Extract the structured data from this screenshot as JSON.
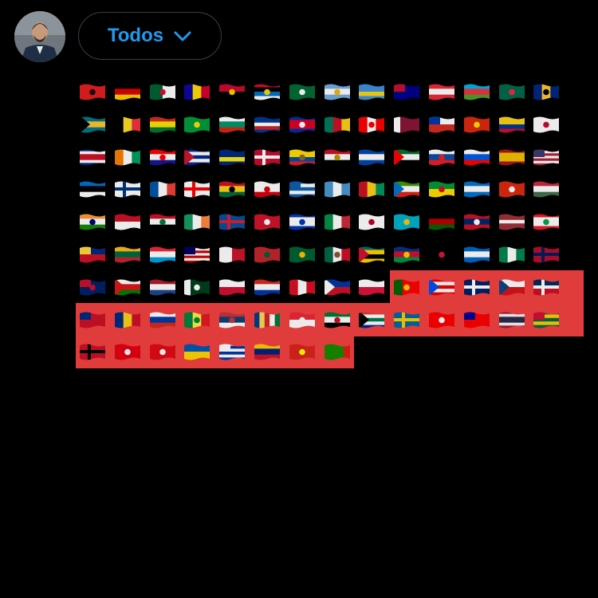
{
  "header": {
    "avatar_alt": "avatar",
    "dropdown": {
      "label": "Todos",
      "icon": "chevron-down-icon"
    }
  },
  "colors": {
    "accent": "#1d9bf0",
    "highlight": "#e03c3c",
    "background": "#000000"
  },
  "flags": [
    {
      "name": "albania",
      "bands": [
        "#e41e20"
      ],
      "dir": "h",
      "emblem": "#111"
    },
    {
      "name": "germany",
      "bands": [
        "#000",
        "#dd0000",
        "#ffce00"
      ],
      "dir": "h"
    },
    {
      "name": "algeria",
      "bands": [
        "#006233",
        "#ffffff"
      ],
      "dir": "v",
      "emblem": "#d21034"
    },
    {
      "name": "andorra",
      "bands": [
        "#10069f",
        "#fedd00",
        "#d50032"
      ],
      "dir": "v"
    },
    {
      "name": "angola",
      "bands": [
        "#cc092f",
        "#000000"
      ],
      "dir": "h",
      "emblem": "#ffcb00"
    },
    {
      "name": "antigua-barbuda",
      "bands": [
        "#ce1126",
        "#000",
        "#0072c6",
        "#fff"
      ],
      "dir": "h",
      "emblem": "#fcd116"
    },
    {
      "name": "saudi-arabia",
      "bands": [
        "#006c35"
      ],
      "dir": "h",
      "emblem": "#fff"
    },
    {
      "name": "argentina",
      "bands": [
        "#74acdf",
        "#ffffff",
        "#74acdf"
      ],
      "dir": "h",
      "emblem": "#f6b40e"
    },
    {
      "name": "aruba",
      "bands": [
        "#418fde",
        "#418fde",
        "#f9d616",
        "#418fde"
      ],
      "dir": "h"
    },
    {
      "name": "australia",
      "bands": [
        "#00008b"
      ],
      "dir": "h",
      "canton": "#c8102e"
    },
    {
      "name": "austria",
      "bands": [
        "#ed2939",
        "#ffffff",
        "#ed2939"
      ],
      "dir": "h"
    },
    {
      "name": "azerbaijan",
      "bands": [
        "#00b5e2",
        "#ef3340",
        "#509e2f"
      ],
      "dir": "h"
    },
    {
      "name": "bangladesh",
      "bands": [
        "#006a4e"
      ],
      "dir": "h",
      "emblem": "#f42a41"
    },
    {
      "name": "barbados",
      "bands": [
        "#00267f",
        "#ffc726",
        "#00267f"
      ],
      "dir": "v",
      "emblem": "#000"
    },
    {
      "name": "bahamas",
      "bands": [
        "#00778b",
        "#ffc72c",
        "#00778b"
      ],
      "dir": "h",
      "tri": "#000"
    },
    {
      "name": "belgium",
      "bands": [
        "#000",
        "#fdda24",
        "#ef3340"
      ],
      "dir": "v"
    },
    {
      "name": "bolivia",
      "bands": [
        "#d52b1e",
        "#f9e300",
        "#007934"
      ],
      "dir": "h"
    },
    {
      "name": "brazil",
      "bands": [
        "#009c3b"
      ],
      "dir": "h",
      "emblem": "#ffdf00"
    },
    {
      "name": "bulgaria",
      "bands": [
        "#ffffff",
        "#00966e",
        "#d62612"
      ],
      "dir": "h"
    },
    {
      "name": "cape-verde",
      "bands": [
        "#003893",
        "#003893",
        "#fff",
        "#cf2027",
        "#003893"
      ],
      "dir": "h"
    },
    {
      "name": "cambodia",
      "bands": [
        "#032ea1",
        "#e00025",
        "#e00025",
        "#032ea1"
      ],
      "dir": "h",
      "emblem": "#fff"
    },
    {
      "name": "cameroon",
      "bands": [
        "#007a5e",
        "#ce1126",
        "#fcd116"
      ],
      "dir": "v"
    },
    {
      "name": "canada",
      "bands": [
        "#ff0000",
        "#ffffff",
        "#ff0000"
      ],
      "dir": "v",
      "emblem": "#ff0000"
    },
    {
      "name": "qatar",
      "bands": [
        "#ffffff",
        "#8a1538",
        "#8a1538",
        "#8a1538"
      ],
      "dir": "v"
    },
    {
      "name": "chile",
      "bands": [
        "#ffffff",
        "#d52b1e"
      ],
      "dir": "h",
      "canton": "#0039a6"
    },
    {
      "name": "china",
      "bands": [
        "#de2910"
      ],
      "dir": "h",
      "canton": "#de2910",
      "emblem": "#ffde00"
    },
    {
      "name": "colombia",
      "bands": [
        "#fcd116",
        "#fcd116",
        "#003893",
        "#ce1126"
      ],
      "dir": "h"
    },
    {
      "name": "south-korea",
      "bands": [
        "#ffffff"
      ],
      "dir": "h",
      "emblem": "#c60c30"
    },
    {
      "name": "costa-rica",
      "bands": [
        "#002b7f",
        "#fff",
        "#ce1126",
        "#ce1126",
        "#fff",
        "#002b7f"
      ],
      "dir": "h"
    },
    {
      "name": "ivory-coast",
      "bands": [
        "#f77f00",
        "#ffffff",
        "#009e60"
      ],
      "dir": "v"
    },
    {
      "name": "croatia",
      "bands": [
        "#ff0000",
        "#ffffff",
        "#171796"
      ],
      "dir": "h",
      "emblem": "#ff0000"
    },
    {
      "name": "cuba",
      "bands": [
        "#002a8f",
        "#fff",
        "#002a8f",
        "#fff",
        "#002a8f"
      ],
      "dir": "h",
      "tri": "#cf142b"
    },
    {
      "name": "curacao",
      "bands": [
        "#002b7f",
        "#002b7f",
        "#f9e814",
        "#002b7f"
      ],
      "dir": "h"
    },
    {
      "name": "denmark",
      "bands": [
        "#c60c30"
      ],
      "dir": "h",
      "cross": "#fff"
    },
    {
      "name": "ecuador",
      "bands": [
        "#ffdd00",
        "#ffdd00",
        "#034ea2",
        "#ed1c24"
      ],
      "dir": "h",
      "emblem": "#8b6b2e"
    },
    {
      "name": "egypt",
      "bands": [
        "#ce1126",
        "#ffffff",
        "#000000"
      ],
      "dir": "h",
      "emblem": "#c09300"
    },
    {
      "name": "el-salvador",
      "bands": [
        "#0047ab",
        "#ffffff",
        "#0047ab"
      ],
      "dir": "h"
    },
    {
      "name": "uae",
      "bands": [
        "#00732f",
        "#ffffff",
        "#000000"
      ],
      "dir": "h",
      "tri": "#ff0000"
    },
    {
      "name": "slovakia",
      "bands": [
        "#ffffff",
        "#0b4ea2",
        "#ee1c25"
      ],
      "dir": "h",
      "emblem": "#ee1c25"
    },
    {
      "name": "slovenia",
      "bands": [
        "#ffffff",
        "#005ce6",
        "#ff0000"
      ],
      "dir": "h"
    },
    {
      "name": "spain",
      "bands": [
        "#aa151b",
        "#f1bf00",
        "#f1bf00",
        "#aa151b"
      ],
      "dir": "h"
    },
    {
      "name": "united-states",
      "bands": [
        "#b22234",
        "#fff",
        "#b22234",
        "#fff",
        "#b22234",
        "#fff",
        "#b22234"
      ],
      "dir": "h",
      "canton": "#3c3b6e"
    },
    {
      "name": "estonia",
      "bands": [
        "#0072ce",
        "#000000",
        "#ffffff"
      ],
      "dir": "h"
    },
    {
      "name": "finland",
      "bands": [
        "#ffffff"
      ],
      "dir": "h",
      "cross": "#003580"
    },
    {
      "name": "france",
      "bands": [
        "#0055a4",
        "#ffffff",
        "#ef4135"
      ],
      "dir": "v"
    },
    {
      "name": "georgia",
      "bands": [
        "#ffffff"
      ],
      "dir": "h",
      "cross": "#ff0000"
    },
    {
      "name": "ghana",
      "bands": [
        "#ce1126",
        "#fcd116",
        "#006b3f"
      ],
      "dir": "h",
      "emblem": "#000"
    },
    {
      "name": "gibraltar",
      "bands": [
        "#ffffff",
        "#ffffff",
        "#da000c"
      ],
      "dir": "h",
      "emblem": "#da000c"
    },
    {
      "name": "greece",
      "bands": [
        "#0d5eaf",
        "#fff",
        "#0d5eaf",
        "#fff",
        "#0d5eaf"
      ],
      "dir": "h",
      "canton": "#0d5eaf"
    },
    {
      "name": "guatemala",
      "bands": [
        "#4997d0",
        "#ffffff",
        "#4997d0"
      ],
      "dir": "v"
    },
    {
      "name": "guinea",
      "bands": [
        "#ce1126",
        "#fcd116",
        "#009460"
      ],
      "dir": "v"
    },
    {
      "name": "equatorial-guinea",
      "bands": [
        "#3e9a00",
        "#ffffff",
        "#e32118"
      ],
      "dir": "h",
      "tri": "#0073ce"
    },
    {
      "name": "french-guiana",
      "bands": [
        "#009739",
        "#fedf00"
      ],
      "dir": "h",
      "emblem": "#e20e17"
    },
    {
      "name": "honduras",
      "bands": [
        "#0073cf",
        "#ffffff",
        "#0073cf"
      ],
      "dir": "h"
    },
    {
      "name": "hong-kong",
      "bands": [
        "#de2910"
      ],
      "dir": "h",
      "emblem": "#fff"
    },
    {
      "name": "hungary",
      "bands": [
        "#cd2a3e",
        "#ffffff",
        "#436f4d"
      ],
      "dir": "h"
    },
    {
      "name": "india",
      "bands": [
        "#ff9933",
        "#ffffff",
        "#138808"
      ],
      "dir": "h",
      "emblem": "#000080"
    },
    {
      "name": "indonesia",
      "bands": [
        "#ce1126",
        "#ffffff"
      ],
      "dir": "h"
    },
    {
      "name": "iraq",
      "bands": [
        "#ce1126",
        "#ffffff",
        "#000000"
      ],
      "dir": "h",
      "emblem": "#007a3d"
    },
    {
      "name": "ireland",
      "bands": [
        "#169b62",
        "#ffffff",
        "#ff883e"
      ],
      "dir": "v"
    },
    {
      "name": "iceland",
      "bands": [
        "#02529c"
      ],
      "dir": "h",
      "cross": "#dc1e35"
    },
    {
      "name": "isle-of-man",
      "bands": [
        "#cf142b"
      ],
      "dir": "h",
      "emblem": "#fff"
    },
    {
      "name": "israel",
      "bands": [
        "#0038b8",
        "#ffffff",
        "#ffffff",
        "#0038b8"
      ],
      "dir": "h",
      "emblem": "#0038b8"
    },
    {
      "name": "italy",
      "bands": [
        "#009246",
        "#ffffff",
        "#ce2b37"
      ],
      "dir": "v"
    },
    {
      "name": "japan",
      "bands": [
        "#ffffff"
      ],
      "dir": "h",
      "emblem": "#bc002d"
    },
    {
      "name": "kazakhstan",
      "bands": [
        "#00afca"
      ],
      "dir": "h",
      "emblem": "#fec50c"
    },
    {
      "name": "kenya",
      "bands": [
        "#000000",
        "#bb0000",
        "#006600"
      ],
      "dir": "h",
      "emblem": "#bb0000"
    },
    {
      "name": "laos",
      "bands": [
        "#ce1126",
        "#002868",
        "#ce1126"
      ],
      "dir": "h",
      "emblem": "#fff"
    },
    {
      "name": "latvia",
      "bands": [
        "#9e3039",
        "#9e3039",
        "#ffffff",
        "#9e3039",
        "#9e3039"
      ],
      "dir": "h"
    },
    {
      "name": "lebanon",
      "bands": [
        "#ed1c24",
        "#ffffff",
        "#ffffff",
        "#ed1c24"
      ],
      "dir": "h",
      "emblem": "#00a651"
    },
    {
      "name": "liechtenstein",
      "bands": [
        "#002b7f",
        "#ce1126"
      ],
      "dir": "h",
      "canton": "#ffd83d"
    },
    {
      "name": "lithuania",
      "bands": [
        "#fdb913",
        "#006a44",
        "#c1272d"
      ],
      "dir": "h"
    },
    {
      "name": "luxembourg",
      "bands": [
        "#ed2939",
        "#ffffff",
        "#00a1de"
      ],
      "dir": "h"
    },
    {
      "name": "malaysia",
      "bands": [
        "#cc0001",
        "#fff",
        "#cc0001",
        "#fff",
        "#cc0001",
        "#fff",
        "#cc0001"
      ],
      "dir": "h",
      "canton": "#010066"
    },
    {
      "name": "malta",
      "bands": [
        "#ffffff",
        "#cf142b"
      ],
      "dir": "v"
    },
    {
      "name": "morocco",
      "bands": [
        "#c1272d"
      ],
      "dir": "h",
      "emblem": "#006233"
    },
    {
      "name": "mauritania",
      "bands": [
        "#006233"
      ],
      "dir": "h",
      "emblem": "#ffc400"
    },
    {
      "name": "mexico",
      "bands": [
        "#006847",
        "#ffffff",
        "#ce1126"
      ],
      "dir": "v",
      "emblem": "#8b5a2b"
    },
    {
      "name": "mozambique",
      "bands": [
        "#007168",
        "#ffd100",
        "#000000",
        "#ffd100"
      ],
      "dir": "h",
      "tri": "#d21034"
    },
    {
      "name": "namibia",
      "bands": [
        "#003580",
        "#d21034",
        "#009543"
      ],
      "dir": "h",
      "emblem": "#ffce00"
    },
    {
      "name": "nepal",
      "bands": [
        "#000000"
      ],
      "dir": "h",
      "emblem": "#dc143c"
    },
    {
      "name": "nicaragua",
      "bands": [
        "#0067c6",
        "#ffffff",
        "#0067c6"
      ],
      "dir": "h"
    },
    {
      "name": "nigeria",
      "bands": [
        "#008751",
        "#ffffff",
        "#008751"
      ],
      "dir": "v"
    },
    {
      "name": "norway",
      "bands": [
        "#ba0c2f"
      ],
      "dir": "h",
      "cross": "#00205b"
    },
    {
      "name": "new-zealand",
      "bands": [
        "#012169"
      ],
      "dir": "h",
      "canton": "#c8102e",
      "emblem": "#c8102e"
    },
    {
      "name": "oman",
      "bands": [
        "#ffffff",
        "#db161b",
        "#008000"
      ],
      "dir": "h",
      "tri": "#db161b"
    },
    {
      "name": "netherlands",
      "bands": [
        "#ae1c28",
        "#ffffff",
        "#21468b"
      ],
      "dir": "h"
    },
    {
      "name": "pakistan",
      "bands": [
        "#ffffff",
        "#01411c",
        "#01411c",
        "#01411c"
      ],
      "dir": "v",
      "emblem": "#fff"
    },
    {
      "name": "panama",
      "bands": [
        "#ffffff",
        "#d21034"
      ],
      "dir": "h",
      "canton": "#ffffff"
    },
    {
      "name": "paraguay",
      "bands": [
        "#d52b1e",
        "#ffffff",
        "#0038a8"
      ],
      "dir": "h"
    },
    {
      "name": "peru",
      "bands": [
        "#d91023",
        "#ffffff",
        "#d91023"
      ],
      "dir": "v"
    },
    {
      "name": "philippines",
      "bands": [
        "#0038a8",
        "#ce1126"
      ],
      "dir": "h",
      "tri": "#ffffff"
    },
    {
      "name": "poland",
      "bands": [
        "#ffffff",
        "#dc143c"
      ],
      "dir": "h"
    },
    {
      "name": "portugal",
      "bands": [
        "#006600",
        "#ff0000",
        "#ff0000"
      ],
      "dir": "v",
      "emblem": "#ffcc00"
    },
    {
      "name": "puerto-rico",
      "bands": [
        "#ed0000",
        "#fff",
        "#ed0000",
        "#fff",
        "#ed0000"
      ],
      "dir": "h",
      "tri": "#0050f0"
    },
    {
      "name": "united-kingdom",
      "bands": [
        "#012169"
      ],
      "dir": "h",
      "cross": "#ffffff"
    },
    {
      "name": "czech-republic",
      "bands": [
        "#ffffff",
        "#d7141a"
      ],
      "dir": "h",
      "tri": "#11457e"
    },
    {
      "name": "dominican-republic",
      "bands": [
        "#002d62",
        "#ce1126"
      ],
      "dir": "h",
      "cross": "#ffffff"
    },
    {
      "name": "samoa",
      "bands": [
        "#ce1126"
      ],
      "dir": "h",
      "canton": "#002b7f"
    },
    {
      "name": "romania",
      "bands": [
        "#002b7f",
        "#fcd116",
        "#ce1126"
      ],
      "dir": "v"
    },
    {
      "name": "russia",
      "bands": [
        "#ffffff",
        "#0039a6",
        "#d52b1e"
      ],
      "dir": "h"
    },
    {
      "name": "senegal",
      "bands": [
        "#00853f",
        "#fdef42",
        "#e31b23"
      ],
      "dir": "v",
      "emblem": "#00853f"
    },
    {
      "name": "serbia",
      "bands": [
        "#c6363c",
        "#0c4076",
        "#ffffff"
      ],
      "dir": "h",
      "emblem": "#c6363c"
    },
    {
      "name": "seychelles",
      "bands": [
        "#003f87",
        "#fcd856",
        "#d62828",
        "#ffffff",
        "#007a3d"
      ],
      "dir": "v"
    },
    {
      "name": "singapore",
      "bands": [
        "#ed2939",
        "#ffffff"
      ],
      "dir": "h",
      "emblem": "#fff"
    },
    {
      "name": "syria",
      "bands": [
        "#007a3d",
        "#ffffff",
        "#000000"
      ],
      "dir": "h",
      "emblem": "#ce1126"
    },
    {
      "name": "south-africa",
      "bands": [
        "#de3831",
        "#ffffff",
        "#007a4d",
        "#ffffff",
        "#002395"
      ],
      "dir": "h",
      "tri": "#000"
    },
    {
      "name": "sweden",
      "bands": [
        "#006aa7"
      ],
      "dir": "h",
      "cross": "#fecc00"
    },
    {
      "name": "switzerland",
      "bands": [
        "#ff0000"
      ],
      "dir": "h",
      "emblem": "#fff"
    },
    {
      "name": "taiwan",
      "bands": [
        "#fe0000"
      ],
      "dir": "h",
      "canton": "#000095"
    },
    {
      "name": "thailand",
      "bands": [
        "#a51931",
        "#f4f5f8",
        "#2d2a4a",
        "#2d2a4a",
        "#f4f5f8",
        "#a51931"
      ],
      "dir": "h"
    },
    {
      "name": "togo",
      "bands": [
        "#006a4e",
        "#ffce00",
        "#006a4e",
        "#ffce00",
        "#006a4e"
      ],
      "dir": "h",
      "canton": "#d21034"
    },
    {
      "name": "trinidad-tobago",
      "bands": [
        "#ce1126"
      ],
      "dir": "h",
      "cross": "#000"
    },
    {
      "name": "tunisia",
      "bands": [
        "#e70013"
      ],
      "dir": "h",
      "emblem": "#fff"
    },
    {
      "name": "turkey",
      "bands": [
        "#e30a17"
      ],
      "dir": "h",
      "emblem": "#fff"
    },
    {
      "name": "ukraine",
      "bands": [
        "#0057b7",
        "#ffd700"
      ],
      "dir": "h"
    },
    {
      "name": "uruguay",
      "bands": [
        "#fff",
        "#0038a8",
        "#fff",
        "#0038a8",
        "#fff",
        "#0038a8"
      ],
      "dir": "h",
      "canton": "#ffffff"
    },
    {
      "name": "venezuela",
      "bands": [
        "#ffcc00",
        "#00247d",
        "#cf142b"
      ],
      "dir": "h"
    },
    {
      "name": "vietnam",
      "bands": [
        "#da251d"
      ],
      "dir": "h",
      "emblem": "#ffff00"
    },
    {
      "name": "zambia",
      "bands": [
        "#198a00",
        "#198a00",
        "#198a00",
        "#de2010"
      ],
      "dir": "v"
    }
  ],
  "highlighted_flags": {
    "from_row": 6,
    "from_col": 9,
    "to_row": 8,
    "to_col": 7
  }
}
